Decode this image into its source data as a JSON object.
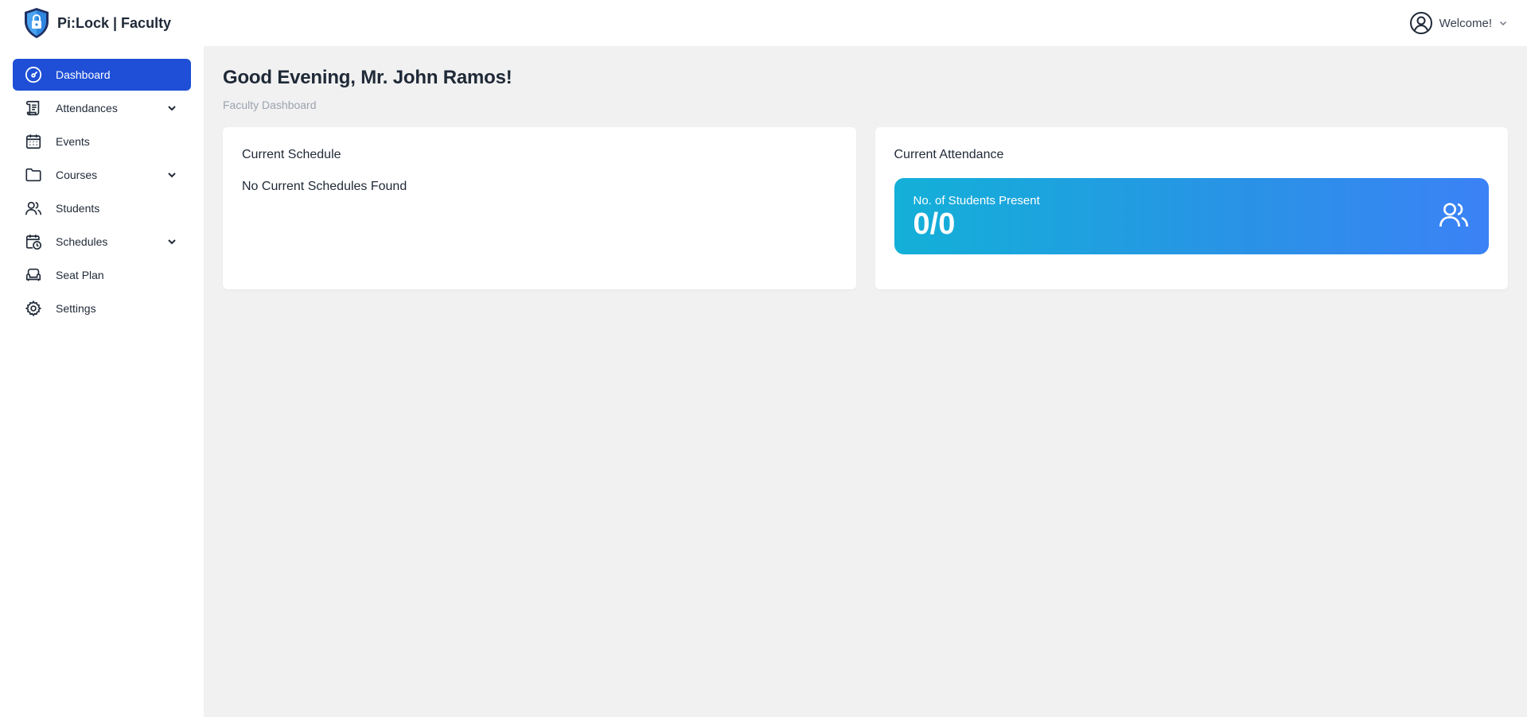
{
  "header": {
    "brand": "Pi:Lock | Faculty",
    "logo_icon": "shield-lock-icon",
    "user_menu_label": "Welcome!",
    "user_icon": "user-circle-icon"
  },
  "sidebar": {
    "items": [
      {
        "label": "Dashboard",
        "icon": "gauge-icon",
        "active": true,
        "expandable": false
      },
      {
        "label": "Attendances",
        "icon": "scroll-icon",
        "active": false,
        "expandable": true
      },
      {
        "label": "Events",
        "icon": "calendar-icon",
        "active": false,
        "expandable": false
      },
      {
        "label": "Courses",
        "icon": "folder-icon",
        "active": false,
        "expandable": true
      },
      {
        "label": "Students",
        "icon": "users-icon",
        "active": false,
        "expandable": false
      },
      {
        "label": "Schedules",
        "icon": "calendar-clock-icon",
        "active": false,
        "expandable": true
      },
      {
        "label": "Seat Plan",
        "icon": "armchair-icon",
        "active": false,
        "expandable": false
      },
      {
        "label": "Settings",
        "icon": "gear-icon",
        "active": false,
        "expandable": false
      }
    ]
  },
  "main": {
    "greeting": "Good Evening, Mr. John Ramos!",
    "subtitle": "Faculty Dashboard",
    "schedule_card": {
      "title": "Current Schedule",
      "empty_text": "No Current Schedules Found"
    },
    "attendance_card": {
      "title": "Current Attendance",
      "stat_label": "No. of Students Present",
      "stat_value": "0/0",
      "stat_icon": "users-icon"
    }
  },
  "colors": {
    "accent": "#1e4fd6",
    "gradient_start": "#13b0d8",
    "gradient_end": "#3b82f6",
    "background": "#f1f1f1"
  }
}
